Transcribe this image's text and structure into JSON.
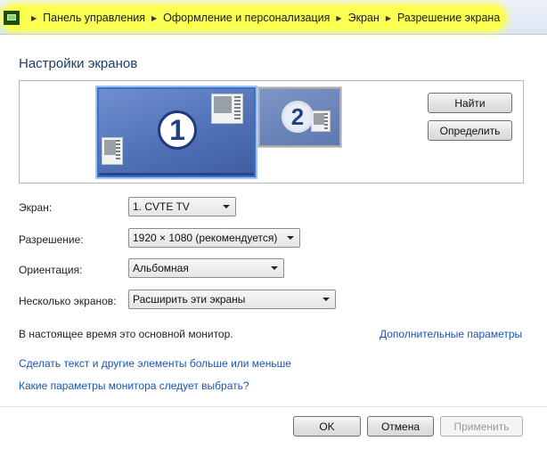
{
  "breadcrumb": [
    "Панель управления",
    "Оформление и персонализация",
    "Экран",
    "Разрешение экрана"
  ],
  "page_title": "Настройки экранов",
  "monitors": [
    {
      "number": "1"
    },
    {
      "number": "2"
    }
  ],
  "preview_buttons": {
    "find": "Найти",
    "identify": "Определить"
  },
  "form": {
    "display_label": "Экран:",
    "display_value": "1. CVTE TV",
    "resolution_label": "Разрешение:",
    "resolution_value": "1920 × 1080 (рекомендуется)",
    "orientation_label": "Ориентация:",
    "orientation_value": "Альбомная",
    "multiple_label": "Несколько экранов:",
    "multiple_value": "Расширить эти экраны"
  },
  "info_text": "В настоящее время это основной монитор.",
  "links": {
    "advanced": "Дополнительные параметры",
    "text_size": "Сделать текст и другие элементы больше или меньше",
    "which_settings": "Какие параметры монитора следует выбрать?"
  },
  "footer": {
    "ok": "OK",
    "cancel": "Отмена",
    "apply": "Применить"
  },
  "colors": {
    "highlight": "#fbff52",
    "link": "#1a55b0",
    "title": "#1c3a6b"
  }
}
